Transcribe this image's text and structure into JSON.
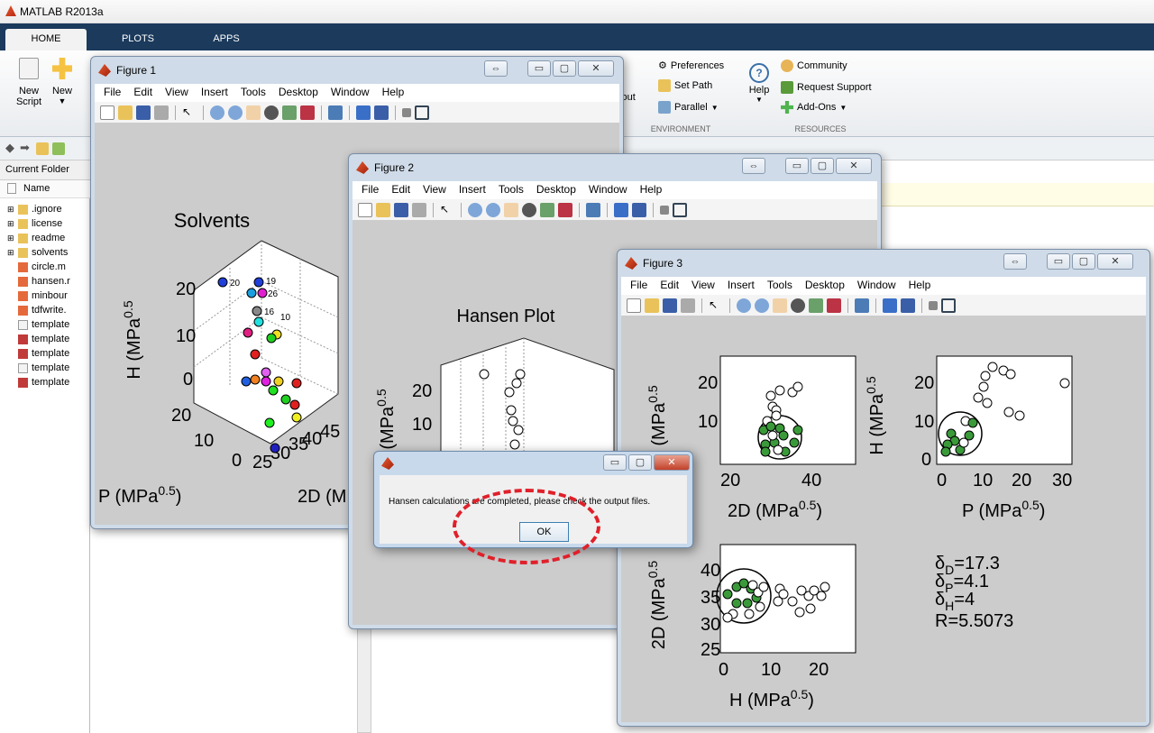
{
  "app_title": "MATLAB R2013a",
  "ribbon_tabs": [
    "HOME",
    "PLOTS",
    "APPS"
  ],
  "ribbon": {
    "new_script": "New Script",
    "new": "New",
    "layout_fragment": "yout",
    "preferences": "Preferences",
    "set_path": "Set Path",
    "parallel": "Parallel",
    "environment": "ENVIRONMENT",
    "help": "Help",
    "community": "Community",
    "request_support": "Request Support",
    "add_ons": "Add-Ons",
    "resources": "RESOURCES"
  },
  "folder": {
    "title": "Current Folder",
    "col_name": "Name",
    "items": [
      ".ignore",
      "license",
      "readme",
      "solvents",
      "circle.m",
      "hansen.r",
      "minbour",
      "tdfwrite.",
      "template",
      "template",
      "template",
      "template",
      "template"
    ]
  },
  "menus": [
    "File",
    "Edit",
    "View",
    "Insert",
    "Tools",
    "Desktop",
    "Window",
    "Help"
  ],
  "fig1": {
    "title": "Figure 1",
    "plot_title": "Solvents",
    "zlabel": "H (MPa",
    "xlabel_left": "P (MPa",
    "xlabel_right": "2D (M",
    "z_ticks": [
      "0",
      "10",
      "20"
    ],
    "p_ticks": [
      "20",
      "10",
      "0"
    ],
    "d_ticks": [
      "25",
      "30",
      "35",
      "40",
      "45"
    ],
    "point_labels": [
      "20",
      "19",
      "26",
      "16",
      "10"
    ]
  },
  "fig2": {
    "title": "Figure 2",
    "plot_title": "Hansen Plot",
    "zlabel": "(MPa",
    "z_ticks": [
      "20",
      "10"
    ]
  },
  "fig3": {
    "title": "Figure 3",
    "ax1": {
      "xlabel": "2D (MPa",
      "ylabel": "(MPa",
      "x_ticks": [
        "20",
        "40"
      ],
      "y_ticks": [
        "20",
        "10"
      ]
    },
    "ax2": {
      "xlabel": "P (MPa",
      "ylabel": "H (MPa",
      "x_ticks": [
        "0",
        "10",
        "20",
        "30"
      ],
      "y_ticks": [
        "20",
        "10",
        "0"
      ]
    },
    "ax3": {
      "xlabel": "H (MPa",
      "ylabel": "2D (MPa",
      "x_ticks": [
        "0",
        "10",
        "20"
      ],
      "y_ticks": [
        "40",
        "35",
        "30",
        "25"
      ]
    },
    "exponent": "0.5",
    "params": [
      {
        "sym": "δ",
        "sub": "D",
        "val": "=17.3"
      },
      {
        "sym": "δ",
        "sub": "P",
        "val": "=4.1"
      },
      {
        "sym": "δ",
        "sub": "H",
        "val": "=4"
      },
      {
        "sym": "R",
        "sub": "",
        "val": "=5.5073"
      }
    ]
  },
  "dialog": {
    "message": "Hansen calculations are completed, please check the output files.",
    "ok": "OK"
  },
  "colors": {
    "ribbon_dark": "#1b3a5c",
    "green_point": "#3a9a3a",
    "annotation": "#e0202a"
  }
}
